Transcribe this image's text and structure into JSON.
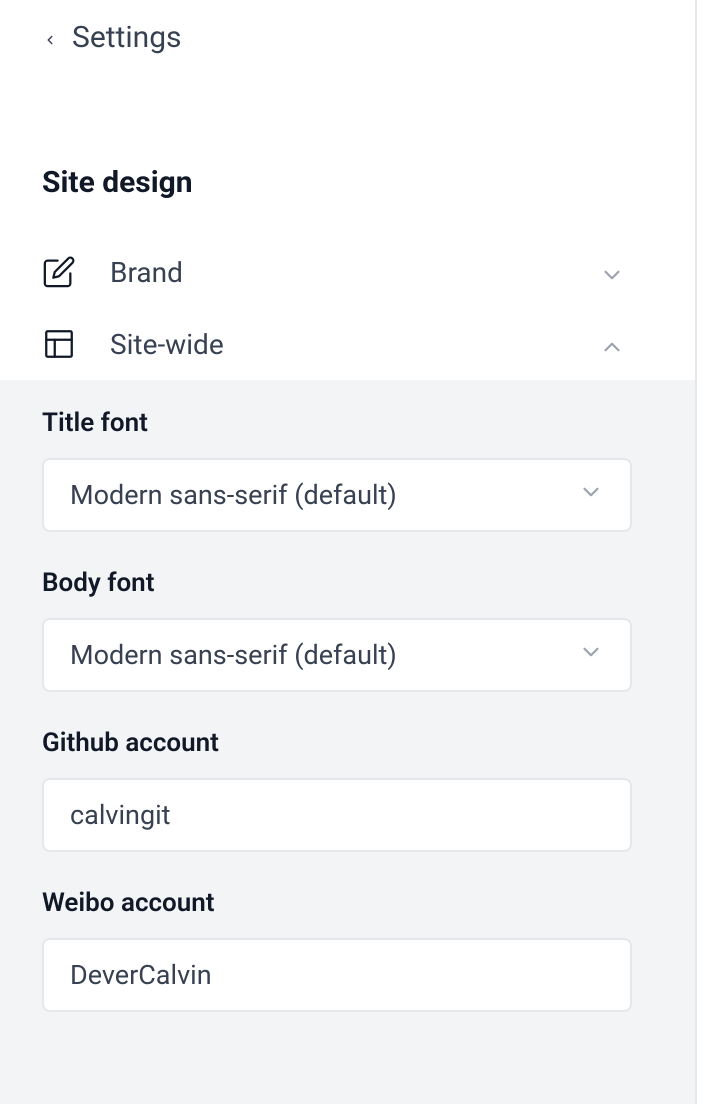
{
  "header": {
    "back_label": "Settings"
  },
  "section": {
    "title": "Site design"
  },
  "collapsibles": {
    "brand": {
      "label": "Brand",
      "expanded": false
    },
    "site_wide": {
      "label": "Site-wide",
      "expanded": true
    }
  },
  "site_wide_form": {
    "title_font": {
      "label": "Title font",
      "value": "Modern sans-serif (default)"
    },
    "body_font": {
      "label": "Body font",
      "value": "Modern sans-serif (default)"
    },
    "github": {
      "label": "Github account",
      "value": "calvingit"
    },
    "weibo": {
      "label": "Weibo account",
      "value": "DeverCalvin"
    }
  }
}
